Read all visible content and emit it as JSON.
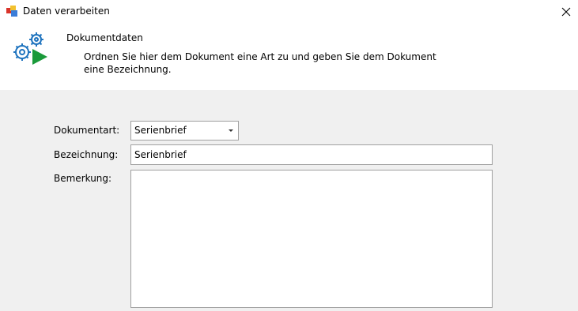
{
  "window": {
    "title": "Daten verarbeiten",
    "icons": {
      "app": "application-icon",
      "close": "close-icon"
    }
  },
  "header": {
    "title": "Dokumentdaten",
    "description": "Ordnen Sie hier dem Dokument eine Art zu und geben Sie dem Dokument eine Bezeichnung.",
    "icon": "gears-play-icon"
  },
  "form": {
    "dokumentart": {
      "label": "Dokumentart:",
      "value": "Serienbrief"
    },
    "bezeichnung": {
      "label": "Bezeichnung:",
      "value": "Serienbrief"
    },
    "bemerkung": {
      "label": "Bemerkung:",
      "value": ""
    }
  },
  "colors": {
    "gear_blue": "#1e73be",
    "play_green": "#1a9a3a",
    "header_bg": "#ffffff",
    "body_bg": "#f0f0f0",
    "field_border": "#a0a0a0"
  }
}
